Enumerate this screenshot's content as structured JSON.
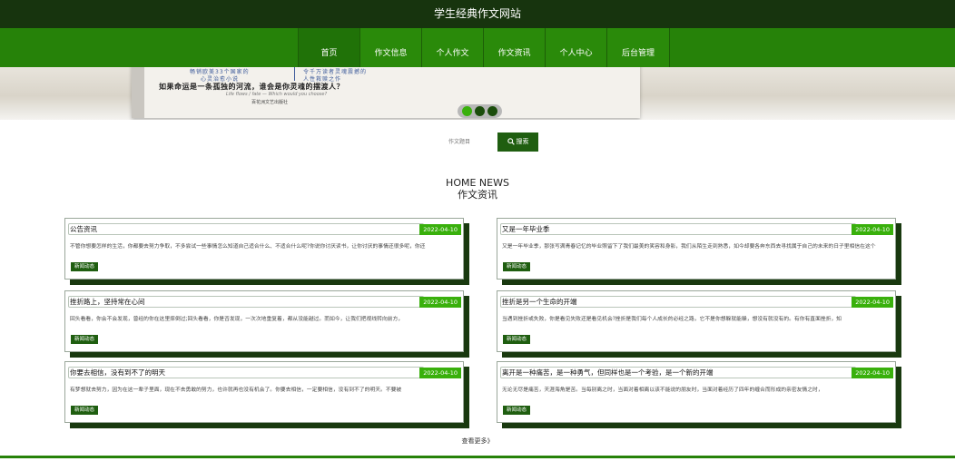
{
  "header": {
    "site_title": "学生经典作文网站"
  },
  "nav": {
    "items": [
      {
        "label": "首页"
      },
      {
        "label": "作文信息"
      },
      {
        "label": "个人作文"
      },
      {
        "label": "作文资讯"
      },
      {
        "label": "个人中心"
      },
      {
        "label": "后台管理"
      }
    ]
  },
  "banner": {
    "line1a": "畅销欧美33个国家的",
    "line1b": "令千万读者灵魂震撼的",
    "line2a": "心灵治愈小说",
    "line2b": "人性救赎之作",
    "book_title": "如果命运是一条孤独的河流，谁会是你灵魂的摆渡人？",
    "book_subtitle": "Life flows / fate — Which would you choose?",
    "publisher": "百花洲文艺出版社",
    "dot_count": 3,
    "active_dot": 0
  },
  "search": {
    "placeholder": "作文题目",
    "button_label": "搜索"
  },
  "section": {
    "title_en": "HOME NEWS",
    "title_cn": "作文资讯"
  },
  "news": [
    {
      "title": "公告资讯",
      "date": "2022-04-10",
      "excerpt": "不管你想要怎样的生活，你都要去努力争取，不多尝试一些事情怎么知道自己适合什么、不适合什么呢?你说你讨厌读书，让你讨厌的事情还很多呢，你还",
      "tag": "新闻动态"
    },
    {
      "title": "又是一年毕业季",
      "date": "2022-04-10",
      "excerpt": "又是一年毕业季，那张写满青春记忆的毕业照留下了我们最美的笑容和身影，我们从陌生走到熟悉，如今却要各奔东西去寻找属于自己的未来的日子里相信在这个",
      "tag": "新闻动态"
    },
    {
      "title": "挫折路上，坚持常在心间",
      "date": "2022-04-10",
      "excerpt": "回头看看，你会不会发现，曾经的你在这里摔倒过;回头看看，你是否发现，一次次地重复着，都从没能越过。而如今，让我们把视线转向前方，",
      "tag": "新闻动态"
    },
    {
      "title": "挫折是另一个生命的开端",
      "date": "2022-04-10",
      "excerpt": "当遇到挫折或失败，你是看见失败还是看见机会?挫折是我们每个人成长的必经之路，它不是你想躲就能躲，想没有就没有的。有你有直面挫折，知",
      "tag": "新闻动态"
    },
    {
      "title": "你要去相信，没有到不了的明天",
      "date": "2022-04-10",
      "excerpt": "有梦想就去努力，因为在这一辈子里面，现在不去勇敢的努力，也许就再也没有机会了。你要去相信，一定要相信，没有到不了的明天。不要被",
      "tag": "新闻动态"
    },
    {
      "title": "离开是一种痛苦，是一种勇气，但同样也是一个考验，是一个新的开端",
      "date": "2022-04-10",
      "excerpt": "无论无尽是痛苦，天涯海角是苦。当每别离之时，当面对着相离以该不能说的朋友时，当面对着经历了四年的缠合而形成的亲密友情之时，",
      "tag": "新闻动态"
    }
  ],
  "more": {
    "label": "查看更多》"
  },
  "colors": {
    "topbar": "#17340e",
    "nav": "#268209",
    "accent": "#39b00c",
    "dark_green": "#1f5e10",
    "card_shadow": "#19390f"
  }
}
